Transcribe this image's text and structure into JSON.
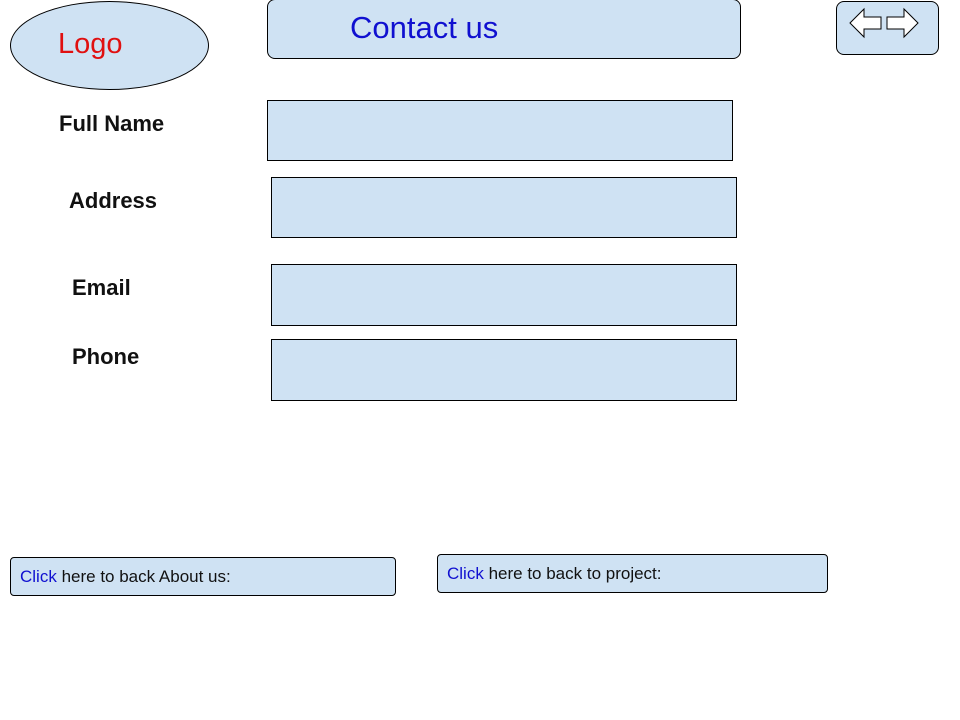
{
  "header": {
    "logo_text": "Logo",
    "title": "Contact us"
  },
  "nav": {
    "back_icon": "arrow-left-outline",
    "forward_icon": "arrow-right-outline"
  },
  "form": {
    "fields": [
      {
        "label": "Full Name",
        "value": "",
        "placeholder": ""
      },
      {
        "label": "Address",
        "value": "",
        "placeholder": ""
      },
      {
        "label": "Email",
        "value": "",
        "placeholder": ""
      },
      {
        "label": "Phone",
        "value": "",
        "placeholder": ""
      }
    ]
  },
  "links": [
    {
      "link_word": "Click",
      "text": " here to back About us:"
    },
    {
      "link_word": "Click",
      "text": " here to back to project:"
    }
  ],
  "colors": {
    "box_fill": "#cfe2f3",
    "border": "#000000",
    "logo_text": "#e01010",
    "title_text": "#1010d0",
    "link_text": "#1010d0"
  }
}
